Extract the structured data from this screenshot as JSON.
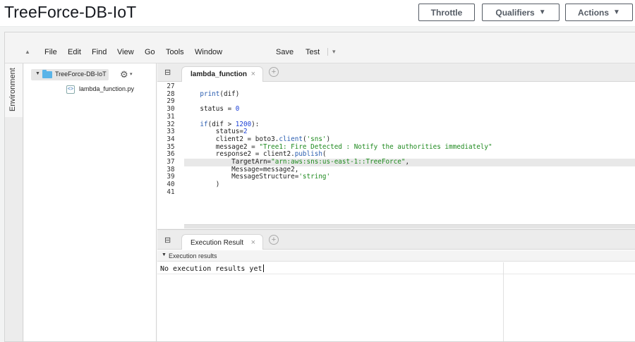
{
  "header": {
    "title": "TreeForce-DB-IoT",
    "buttons": {
      "throttle": "Throttle",
      "qualifiers": "Qualifiers",
      "actions": "Actions"
    }
  },
  "menubar": {
    "items": [
      "File",
      "Edit",
      "Find",
      "View",
      "Go",
      "Tools",
      "Window"
    ],
    "save": "Save",
    "test": "Test"
  },
  "sidebar": {
    "tab_label": "Environment"
  },
  "filetree": {
    "root": "TreeForce-DB-IoT",
    "files": [
      "lambda_function.py"
    ]
  },
  "editor": {
    "tab_label": "lambda_function",
    "active_line": 37,
    "lines": [
      {
        "n": "27",
        "code": ""
      },
      {
        "n": "28",
        "code": "    print(dif)"
      },
      {
        "n": "29",
        "code": ""
      },
      {
        "n": "30",
        "code": "    status = 0"
      },
      {
        "n": "31",
        "code": ""
      },
      {
        "n": "32",
        "code": "    if(dif > 1200):"
      },
      {
        "n": "33",
        "code": "        status=2"
      },
      {
        "n": "34",
        "code": "        client2 = boto3.client('sns')"
      },
      {
        "n": "35",
        "code": "        message2 = \"Tree1: Fire Detected : Notify the authorities immediately\""
      },
      {
        "n": "36",
        "code": "        response2 = client2.publish("
      },
      {
        "n": "37",
        "code": "            TargetArn=\"arn:aws:sns:us-east-1::TreeForce\","
      },
      {
        "n": "38",
        "code": "            Message=message2,"
      },
      {
        "n": "39",
        "code": "            MessageStructure='string'"
      },
      {
        "n": "40",
        "code": "        )"
      },
      {
        "n": "41",
        "code": ""
      }
    ]
  },
  "results": {
    "tab_label": "Execution Result",
    "section_label": "Execution results",
    "body_text": "No execution results yet"
  },
  "colors": {
    "accent_folder": "#5ab4e8",
    "string": "#1f8a1f",
    "number": "#1a3fd6",
    "function": "#2a5db0"
  }
}
